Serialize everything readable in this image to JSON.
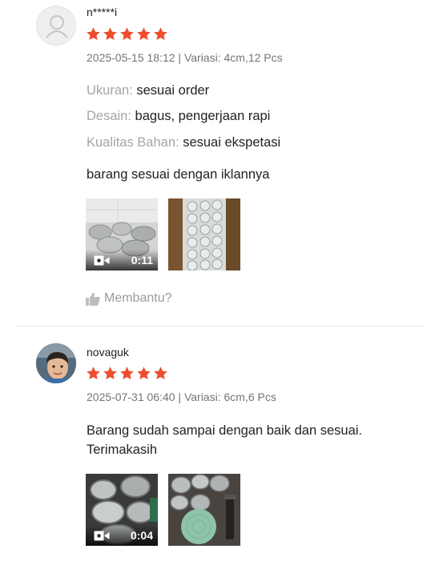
{
  "reviews": [
    {
      "username": "n*****i",
      "rating": 5,
      "meta": "2025-05-15 18:12 | Variasi: 4cm,12 Pcs",
      "attributes": [
        {
          "key": "Ukuran:",
          "value": "sesuai order"
        },
        {
          "key": "Desain:",
          "value": "bagus, pengerjaan rapi"
        },
        {
          "key": "Kualitas Bahan:",
          "value": "sesuai ekspetasi"
        }
      ],
      "comment": "barang sesuai dengan iklannya",
      "video_duration": "0:11",
      "helpful_label": "Membantu?"
    },
    {
      "username": "novaguk",
      "rating": 5,
      "meta": "2025-07-31 06:40 | Variasi: 6cm,6 Pcs",
      "comment": "Barang sudah sampai dengan baik dan sesuai. Terimakasih",
      "video_duration": "0:04"
    }
  ],
  "colors": {
    "star": "#ee4d2d",
    "muted_text": "#757575",
    "attribute_key": "#a5a5a5",
    "divider": "#e8e8e8"
  }
}
